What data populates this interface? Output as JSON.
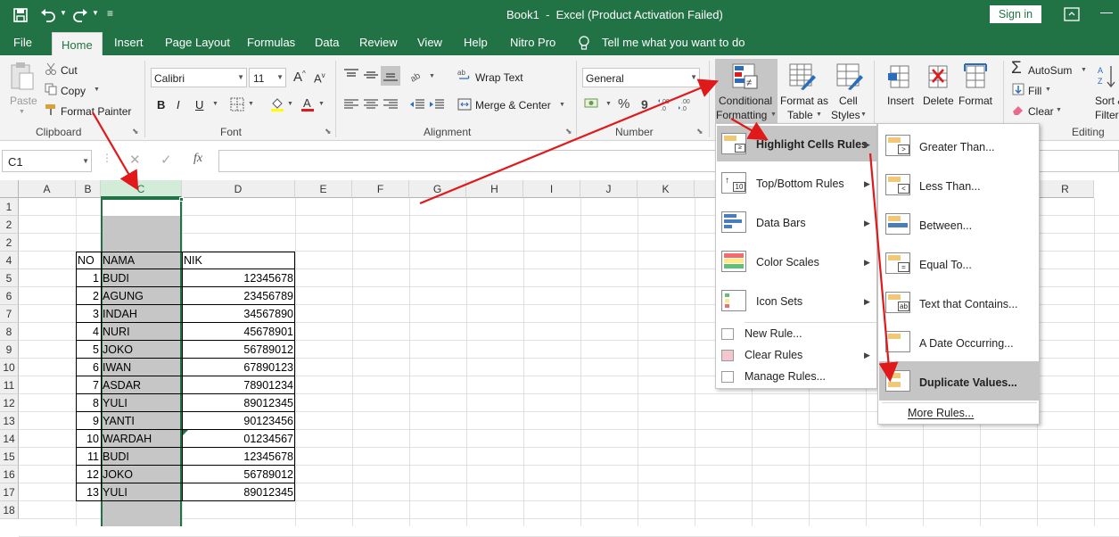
{
  "title_bar": {
    "title": "Book1  -  Excel (Product Activation Failed)",
    "sign_in": "Sign in",
    "qat_more": "≡"
  },
  "tabs": [
    {
      "label": "File"
    },
    {
      "label": "Home"
    },
    {
      "label": "Insert"
    },
    {
      "label": "Page Layout"
    },
    {
      "label": "Formulas"
    },
    {
      "label": "Data"
    },
    {
      "label": "Review"
    },
    {
      "label": "View"
    },
    {
      "label": "Help"
    },
    {
      "label": "Nitro Pro"
    }
  ],
  "tell_me": "Tell me what you want to do",
  "ribbon": {
    "clipboard": {
      "paste": "Paste",
      "cut": "Cut",
      "copy": "Copy",
      "format_painter": "Format Painter",
      "group": "Clipboard"
    },
    "font": {
      "name": "Calibri",
      "size": "11",
      "group": "Font",
      "bold": "B",
      "italic": "I",
      "underline": "U"
    },
    "alignment": {
      "wrap_text": "Wrap Text",
      "merge_center": "Merge & Center",
      "group": "Alignment"
    },
    "number": {
      "format": "General",
      "percent": "%",
      "comma": "9",
      "group": "Number"
    },
    "styles": {
      "conditional_formatting_1": "Conditional",
      "conditional_formatting_2": "Formatting",
      "format_as_table_1": "Format as",
      "format_as_table_2": "Table",
      "cell_styles_1": "Cell",
      "cell_styles_2": "Styles"
    },
    "cells": {
      "insert": "Insert",
      "delete": "Delete",
      "format": "Format"
    },
    "editing": {
      "autosum": "AutoSum",
      "fill": "Fill",
      "clear": "Clear",
      "sort_1": "Sort &",
      "sort_2": "Filter",
      "group": "Editing"
    }
  },
  "formula_bar": {
    "name_box": "C1",
    "fx": "fx",
    "value": ""
  },
  "columns": [
    "A",
    "B",
    "C",
    "D",
    "E",
    "F",
    "G",
    "H",
    "I",
    "J",
    "K",
    "R"
  ],
  "rows": [
    "1",
    "2",
    "2",
    "4",
    "5",
    "6",
    "7",
    "8",
    "9",
    "10",
    "11",
    "12",
    "13",
    "14",
    "15",
    "16",
    "17",
    "18"
  ],
  "table": {
    "headers": [
      "NO",
      "NAMA",
      "NIK"
    ],
    "data": [
      [
        "1",
        "BUDI",
        "12345678"
      ],
      [
        "2",
        "AGUNG",
        "23456789"
      ],
      [
        "3",
        "INDAH",
        "34567890"
      ],
      [
        "4",
        "NURI",
        "45678901"
      ],
      [
        "5",
        "JOKO",
        "56789012"
      ],
      [
        "6",
        "IWAN",
        "67890123"
      ],
      [
        "7",
        "ASDAR",
        "78901234"
      ],
      [
        "8",
        "YULI",
        "89012345"
      ],
      [
        "9",
        "YANTI",
        "90123456"
      ],
      [
        "10",
        "WARDAH",
        "01234567"
      ],
      [
        "11",
        "BUDI",
        "12345678"
      ],
      [
        "12",
        "JOKO",
        "56789012"
      ],
      [
        "13",
        "YULI",
        "89012345"
      ]
    ]
  },
  "cf_menu": {
    "items": [
      "Highlight Cells Rules",
      "Top/Bottom Rules",
      "Data Bars",
      "Color Scales",
      "Icon Sets"
    ],
    "actions": [
      "New Rule...",
      "Clear Rules",
      "Manage Rules..."
    ]
  },
  "hcr_submenu": {
    "items": [
      "Greater Than...",
      "Less Than...",
      "Between...",
      "Equal To...",
      "Text that Contains...",
      "A Date Occurring...",
      "Duplicate Values..."
    ],
    "more": "More Rules..."
  },
  "colors": {
    "excel_green": "#217346",
    "selection": "#c6c6c6",
    "arrow": "#e0191b",
    "menu_hover": "#c5c5c5"
  }
}
